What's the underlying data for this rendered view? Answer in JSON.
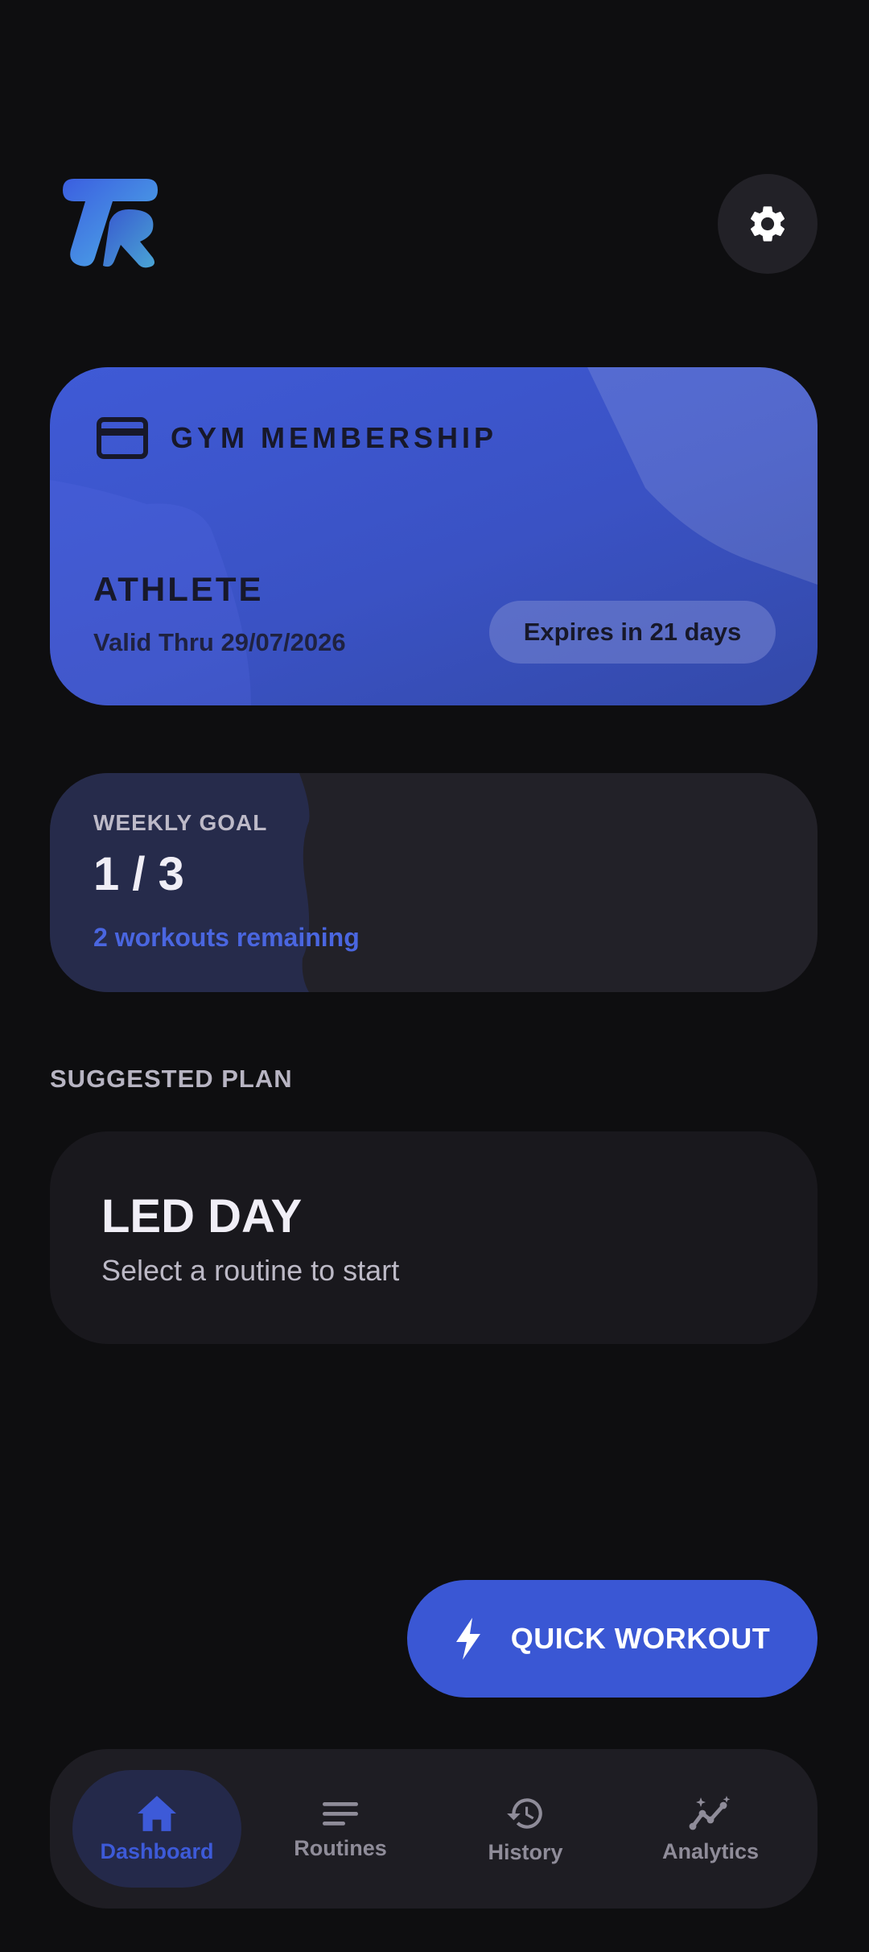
{
  "colors": {
    "accent": "#3a57d4",
    "background": "#0e0e10",
    "card": "#222128"
  },
  "header": {
    "logo_icon": "tk-logo-icon",
    "settings_icon": "gear-icon"
  },
  "membership": {
    "title": "GYM MEMBERSHIP",
    "tier": "ATHLETE",
    "valid": "Valid Thru 29/07/2026",
    "expires": "Expires in 21 days",
    "icon": "credit-card-icon"
  },
  "weekly_goal": {
    "label": "WEEKLY GOAL",
    "count": "1 / 3",
    "completed": 1,
    "target": 3,
    "remaining": "2 workouts remaining"
  },
  "suggested": {
    "section_title": "SUGGESTED PLAN",
    "plan_title": "LED DAY",
    "plan_subtitle": "Select a routine to start"
  },
  "fab": {
    "label": "QUICK WORKOUT",
    "icon": "lightning-bolt-icon"
  },
  "nav": {
    "items": [
      {
        "label": "Dashboard",
        "icon": "home-icon",
        "active": true
      },
      {
        "label": "Routines",
        "icon": "list-icon",
        "active": false
      },
      {
        "label": "History",
        "icon": "history-icon",
        "active": false
      },
      {
        "label": "Analytics",
        "icon": "analytics-icon",
        "active": false
      }
    ]
  }
}
